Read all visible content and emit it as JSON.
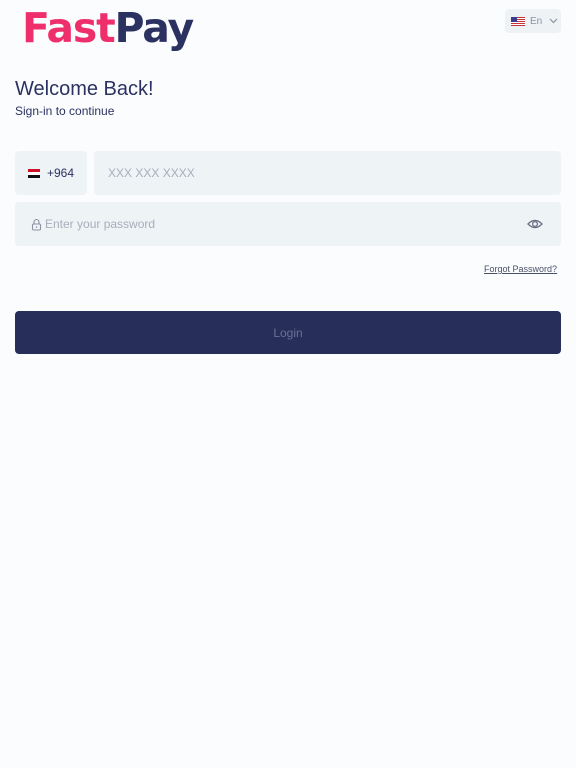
{
  "brand": {
    "logo_part1": "Fast",
    "logo_part2": "Pay",
    "colors": {
      "primary_pink": "#ee2f6c",
      "primary_navy": "#2b3262"
    }
  },
  "language": {
    "selected_label": "En",
    "flag_icon": "us-flag-icon",
    "chevron_icon": "chevron-down-icon"
  },
  "header": {
    "title": "Welcome Back!",
    "subtitle": "Sign-in to continue"
  },
  "form": {
    "country": {
      "flag_icon": "iraq-flag-icon",
      "dial_code": "+964"
    },
    "phone": {
      "value": "",
      "placeholder": "XXX XXX XXXX"
    },
    "password": {
      "value": "",
      "placeholder": "Enter your password",
      "lock_icon": "lock-icon",
      "toggle_icon": "eye-icon"
    },
    "forgot_password_label": "Forgot Password?",
    "login_label": "Login"
  },
  "theme": {
    "background": "#fbfcfd",
    "field_background": "#eef3f6",
    "button_background": "#262e59",
    "button_text": "#6b7295",
    "placeholder_text": "#a6aebb"
  }
}
